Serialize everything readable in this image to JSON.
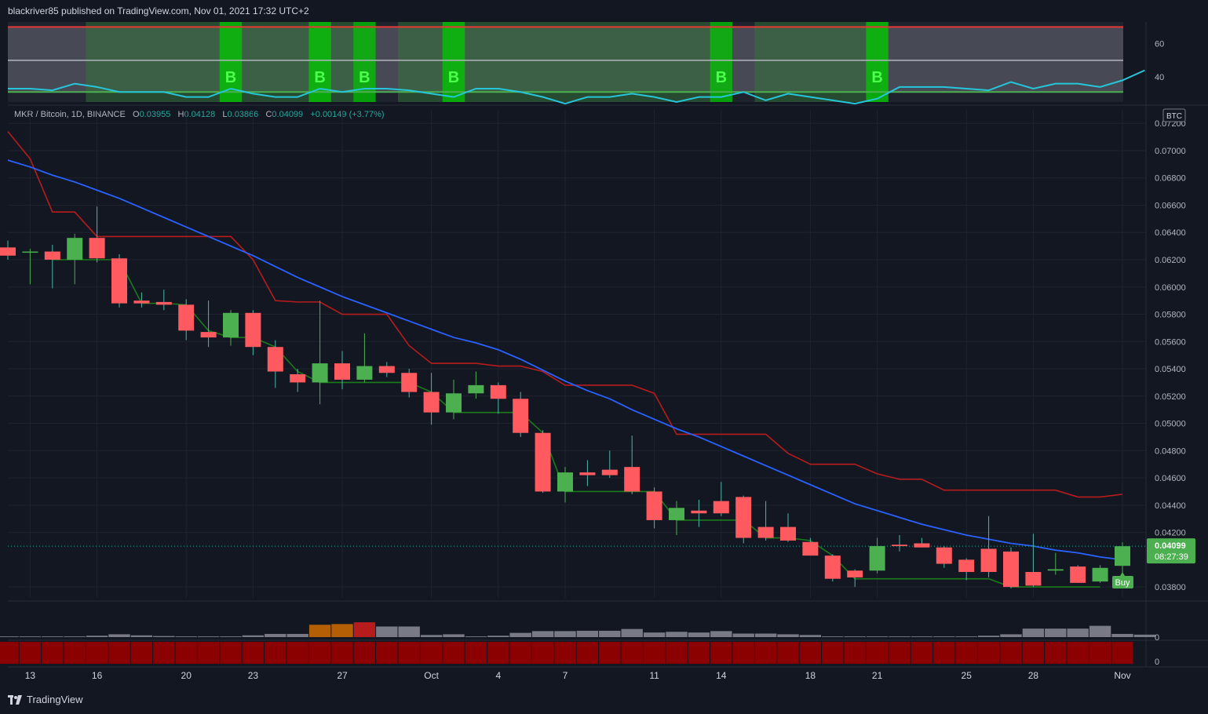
{
  "header": {
    "publisher": "blackriver85 published on TradingView.com, Nov 01, 2021 17:32 UTC+2"
  },
  "legend": {
    "symbol": "MKR / Bitcoin, 1D, BINANCE",
    "open_label": "O",
    "open": "0.03955",
    "high_label": "H",
    "high": "0.04128",
    "low_label": "L",
    "low": "0.03866",
    "close_label": "C",
    "close": "0.04099",
    "change": "+0.00149 (+3.77%)"
  },
  "footer": {
    "brand": "TradingView"
  },
  "colors": {
    "background": "#131722",
    "up": "#4caf50",
    "down": "#ff5a5f",
    "ma_blue": "#2962ff",
    "band_red": "#b71c1c",
    "band_green": "#1b7a1b",
    "osc": "#26c6da"
  },
  "chart_data": [
    {
      "type": "candlestick",
      "quote_currency": "BTC",
      "ylim": [
        0.0372,
        0.0723
      ],
      "y_ticks": [
        "0.07200",
        "0.07000",
        "0.06800",
        "0.06600",
        "0.06400",
        "0.06200",
        "0.06000",
        "0.05800",
        "0.05600",
        "0.05400",
        "0.05200",
        "0.05000",
        "0.04800",
        "0.04600",
        "0.04400",
        "0.04200",
        "0.03800"
      ],
      "x_ticks": [
        "13",
        "16",
        "20",
        "23",
        "27",
        "Oct",
        "4",
        "7",
        "11",
        "14",
        "18",
        "21",
        "25",
        "28",
        "Nov"
      ],
      "x_tick_index": [
        1,
        4,
        8,
        11,
        15,
        19,
        22,
        25,
        29,
        32,
        36,
        39,
        43,
        46,
        50
      ],
      "ohlc": [
        [
          0.0629,
          0.0634,
          0.062,
          0.0623
        ],
        [
          0.0626,
          0.0628,
          0.0602,
          0.0626
        ],
        [
          0.0626,
          0.0631,
          0.0599,
          0.062
        ],
        [
          0.062,
          0.0639,
          0.0602,
          0.0636
        ],
        [
          0.0636,
          0.0659,
          0.0618,
          0.0621
        ],
        [
          0.0621,
          0.0624,
          0.0585,
          0.0588
        ],
        [
          0.059,
          0.0596,
          0.0585,
          0.0588
        ],
        [
          0.0589,
          0.0598,
          0.0583,
          0.0587
        ],
        [
          0.0587,
          0.0591,
          0.0561,
          0.0568
        ],
        [
          0.0567,
          0.059,
          0.0556,
          0.0563
        ],
        [
          0.0563,
          0.0583,
          0.0557,
          0.0581
        ],
        [
          0.0581,
          0.0583,
          0.055,
          0.0556
        ],
        [
          0.0556,
          0.0561,
          0.0526,
          0.0538
        ],
        [
          0.0536,
          0.054,
          0.0523,
          0.053
        ],
        [
          0.053,
          0.059,
          0.0514,
          0.0544
        ],
        [
          0.0544,
          0.0553,
          0.0525,
          0.0532
        ],
        [
          0.0532,
          0.0566,
          0.053,
          0.0542
        ],
        [
          0.0542,
          0.0545,
          0.0534,
          0.0537
        ],
        [
          0.0537,
          0.054,
          0.0519,
          0.0523
        ],
        [
          0.0523,
          0.0537,
          0.0499,
          0.0508
        ],
        [
          0.0508,
          0.0532,
          0.0503,
          0.0522
        ],
        [
          0.0522,
          0.0538,
          0.0518,
          0.0528
        ],
        [
          0.0528,
          0.053,
          0.0507,
          0.0518
        ],
        [
          0.0518,
          0.0523,
          0.049,
          0.0493
        ],
        [
          0.0493,
          0.0495,
          0.0449,
          0.045
        ],
        [
          0.045,
          0.0468,
          0.0442,
          0.0464
        ],
        [
          0.0464,
          0.0473,
          0.0454,
          0.0462
        ],
        [
          0.0466,
          0.048,
          0.046,
          0.0462
        ],
        [
          0.0468,
          0.0491,
          0.0448,
          0.045
        ],
        [
          0.045,
          0.0453,
          0.0423,
          0.0429
        ],
        [
          0.0429,
          0.0443,
          0.0418,
          0.0438
        ],
        [
          0.0436,
          0.0444,
          0.0424,
          0.0434
        ],
        [
          0.0443,
          0.0457,
          0.0432,
          0.0434
        ],
        [
          0.0446,
          0.0447,
          0.0412,
          0.0416
        ],
        [
          0.0424,
          0.0443,
          0.0414,
          0.0416
        ],
        [
          0.0424,
          0.0434,
          0.0413,
          0.0414
        ],
        [
          0.0413,
          0.0416,
          0.0403,
          0.0403
        ],
        [
          0.0403,
          0.0404,
          0.0384,
          0.0386
        ],
        [
          0.0392,
          0.0393,
          0.038,
          0.0387
        ],
        [
          0.0392,
          0.0416,
          0.039,
          0.041
        ],
        [
          0.0411,
          0.0418,
          0.0406,
          0.041
        ],
        [
          0.0412,
          0.0416,
          0.0409,
          0.0409
        ],
        [
          0.0409,
          0.041,
          0.0394,
          0.0397
        ],
        [
          0.04,
          0.0401,
          0.0385,
          0.0391
        ],
        [
          0.0408,
          0.0432,
          0.0387,
          0.0391
        ],
        [
          0.0406,
          0.0409,
          0.0379,
          0.038
        ],
        [
          0.0391,
          0.0419,
          0.038,
          0.0381
        ],
        [
          0.0392,
          0.0405,
          0.0389,
          0.0393
        ],
        [
          0.0395,
          0.0396,
          0.0384,
          0.0383
        ],
        [
          0.0384,
          0.0396,
          0.0383,
          0.0394
        ],
        [
          0.03955,
          0.04128,
          0.03866,
          0.04099
        ]
      ],
      "ma_blue": [
        0.0693,
        0.0688,
        0.0682,
        0.0677,
        0.0671,
        0.0665,
        0.0658,
        0.0651,
        0.0644,
        0.0637,
        0.063,
        0.0623,
        0.0615,
        0.0607,
        0.06,
        0.0593,
        0.0587,
        0.0581,
        0.0575,
        0.0569,
        0.0563,
        0.0559,
        0.0554,
        0.0547,
        0.0539,
        0.0531,
        0.0524,
        0.0518,
        0.051,
        0.0503,
        0.0496,
        0.049,
        0.0483,
        0.0476,
        0.0469,
        0.0462,
        0.0455,
        0.0448,
        0.0441,
        0.0436,
        0.0431,
        0.0426,
        0.0422,
        0.0418,
        0.0415,
        0.0412,
        0.041,
        0.0407,
        0.0405,
        0.0402,
        0.04
      ],
      "band_red": [
        0.0714,
        0.0694,
        0.0655,
        0.0655,
        0.0637,
        0.0637,
        0.0637,
        0.0637,
        0.0637,
        0.0637,
        0.0637,
        0.062,
        0.059,
        0.0589,
        0.0589,
        0.058,
        0.058,
        0.058,
        0.0557,
        0.0544,
        0.0544,
        0.0544,
        0.0542,
        0.0542,
        0.0538,
        0.0528,
        0.0528,
        0.0528,
        0.0528,
        0.0522,
        0.0492,
        0.0492,
        0.0492,
        0.0492,
        0.0492,
        0.0478,
        0.047,
        0.047,
        0.047,
        0.0463,
        0.0459,
        0.0459,
        0.0451,
        0.0451,
        0.0451,
        0.0451,
        0.0451,
        0.0451,
        0.0446,
        0.0446,
        0.0448
      ],
      "band_green": [
        null,
        null,
        0.062,
        0.062,
        0.062,
        0.062,
        0.0588,
        0.0588,
        0.0587,
        0.0568,
        0.0563,
        0.0563,
        0.0556,
        0.0538,
        0.053,
        0.053,
        0.053,
        0.053,
        0.053,
        0.0523,
        0.0508,
        0.0508,
        0.0508,
        0.0508,
        0.0493,
        0.045,
        0.045,
        0.045,
        0.045,
        0.045,
        0.0429,
        0.0429,
        0.0429,
        0.0429,
        0.0416,
        0.0416,
        0.0414,
        0.0403,
        0.0386,
        0.0386,
        0.0386,
        0.0386,
        0.0386,
        0.0386,
        0.0386,
        0.038,
        0.038,
        0.038,
        0.038,
        0.038,
        null
      ],
      "last_price": "0.04099",
      "countdown": "08:27:39",
      "signal_label": "Buy"
    },
    {
      "type": "line",
      "panel": "oscillator",
      "ylim": [
        25,
        73
      ],
      "y_ticks": [
        "60",
        "40"
      ],
      "upper_line": 70,
      "mid_line": 50,
      "lower_line": 31,
      "values": [
        33,
        33,
        32,
        36,
        34,
        31,
        31,
        31,
        28,
        28,
        33,
        30,
        28,
        28,
        33,
        31,
        33,
        33,
        32,
        30,
        28,
        33,
        33,
        31,
        28,
        24,
        28,
        28,
        30,
        28,
        25,
        28,
        28,
        31,
        26,
        30,
        28,
        26,
        24,
        27,
        34,
        34,
        34,
        33,
        32,
        37,
        33,
        36,
        36,
        34,
        38,
        44
      ],
      "buy_label": "B",
      "buy_index": [
        10,
        14,
        16,
        20,
        32,
        39
      ],
      "green_zone_index": [
        4,
        15,
        18,
        31,
        34,
        39
      ]
    },
    {
      "type": "bar",
      "panel": "volume",
      "ylim": [
        0,
        100
      ],
      "y_ticks": [
        "0"
      ],
      "values": [
        2,
        2,
        2,
        2,
        4,
        8,
        5,
        3,
        2,
        2,
        2,
        5,
        9,
        9,
        35,
        37,
        42,
        30,
        30,
        6,
        8,
        2,
        4,
        12,
        17,
        17,
        18,
        18,
        23,
        13,
        15,
        13,
        17,
        10,
        10,
        8,
        6,
        2,
        2,
        2,
        2,
        2,
        2,
        2,
        4,
        8,
        24,
        24,
        24,
        32,
        9,
        7
      ],
      "colors": [
        "#787b86",
        "#787b86",
        "#787b86",
        "#787b86",
        "#787b86",
        "#787b86",
        "#787b86",
        "#787b86",
        "#787b86",
        "#787b86",
        "#787b86",
        "#787b86",
        "#787b86",
        "#787b86",
        "#b45f06",
        "#b45f06",
        "#b71c1c",
        "#787b86",
        "#787b86",
        "#787b86",
        "#787b86",
        "#787b86",
        "#787b86",
        "#787b86",
        "#787b86",
        "#787b86",
        "#787b86",
        "#787b86",
        "#787b86",
        "#787b86",
        "#787b86",
        "#787b86",
        "#787b86",
        "#787b86",
        "#787b86",
        "#787b86",
        "#787b86",
        "#787b86",
        "#787b86",
        "#787b86",
        "#787b86",
        "#787b86",
        "#787b86",
        "#787b86",
        "#787b86",
        "#787b86",
        "#787b86",
        "#787b86",
        "#787b86",
        "#787b86",
        "#787b86",
        "#787b86"
      ]
    },
    {
      "type": "bar",
      "panel": "histogram",
      "y_ticks": [
        "0"
      ],
      "color": "#8b0000"
    }
  ]
}
